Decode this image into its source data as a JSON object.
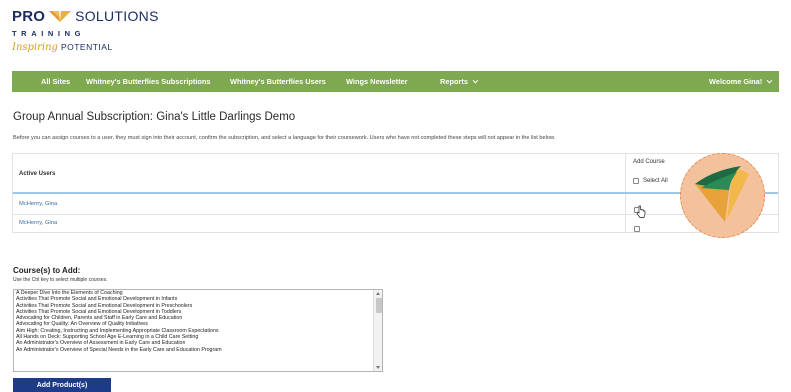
{
  "logo": {
    "pro": "PRO",
    "solutions": "SOLUTIONS",
    "training": "TRAINING",
    "inspiring": "Inspiring",
    "potential": "POTENTIAL"
  },
  "nav": {
    "items": [
      {
        "label": "All Sites"
      },
      {
        "label": "Whitney's Butterflies Subscriptions"
      },
      {
        "label": "Whitney's Butterflies Users"
      },
      {
        "label": "Wings Newsletter"
      },
      {
        "label": "Reports"
      }
    ],
    "welcome": "Welcome Gina!",
    "colors": {
      "bar": "#7ea950"
    }
  },
  "page": {
    "title": "Group Annual Subscription: Gina's Little Darlings Demo",
    "intro": "Before you can assign courses to a user, they must sign into their account, confirm the subscription, and select a language for their coursework. Users who have not completed these steps will not appear in the list below."
  },
  "users_table": {
    "header_active": "Active Users",
    "header_add": "Add Course",
    "select_all": "Select All",
    "rows": [
      {
        "name": "McHenry, Gina"
      },
      {
        "name": "McHenry, Gina"
      }
    ]
  },
  "courses": {
    "label": "Course(s) to Add:",
    "hint": "Use the Ctrl key to select multiple courses.",
    "options": [
      "A Deeper Dive Into the Elements of Coaching",
      "Activities That Promote Social and Emotional Development in Infants",
      "Activities That Promote Social and Emotional Development in Preschoolers",
      "Activities That Promote Social and Emotional Development in Toddlers",
      "Advocating for Children, Parents and Staff in Early Care and Education",
      "Advocating for Quality: An Overview of Quality Initiatives",
      "Aim High: Creating, Instructing and Implementing Appropriate Classroom Expectations",
      "All Hands on Deck: Supporting School Age E-Learning in a Child Care Setting",
      "An Administrator's Overview of Assessment in Early Care and Education",
      "An Administrator's Overview of Special Needs in the Early Care and Education Program"
    ],
    "button": "Add Product(s)"
  },
  "colors": {
    "brand_navy": "#1d2d63",
    "brand_gold": "#d89a2a",
    "button": "#1d3b86",
    "highlight": "#f3c29c"
  }
}
